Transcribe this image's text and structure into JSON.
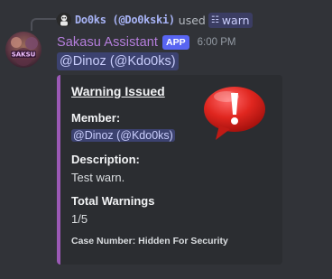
{
  "command": {
    "user": "Do0ks (@Do0kski)",
    "used_text": "used",
    "command_name": "warn",
    "slash_icon": "slash-command-icon"
  },
  "message": {
    "author": "Sakasu Assistant",
    "badge": "APP",
    "timestamp": "6:00 PM",
    "mention": "@Dinoz (@Kdo0ks)",
    "author_color": "#b57edc"
  },
  "embed": {
    "accent_color": "#9b59b6",
    "title": "Warning Issued",
    "thumbnail_icon": "exclamation-bubble-icon",
    "fields": [
      {
        "name": "Member:",
        "value": "@Dinoz (@Kdo0ks)"
      },
      {
        "name": "Description:",
        "value": "Test warn."
      },
      {
        "name": "Total Warnings",
        "value": "1/5"
      }
    ],
    "footer": "Case Number: Hidden For Security"
  }
}
